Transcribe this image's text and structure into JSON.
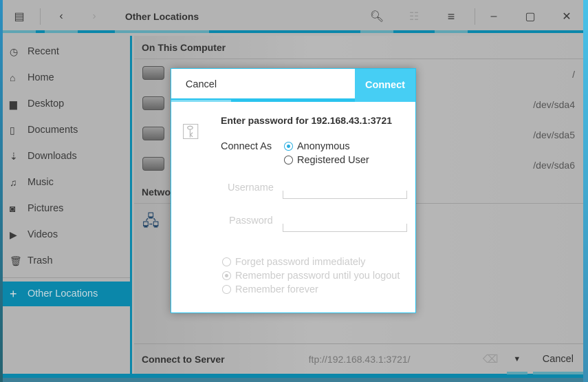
{
  "header": {
    "title": "Other Locations",
    "icons": [
      "files-app-icon",
      "back-icon",
      "forward-icon",
      "search-icon",
      "list-view-icon",
      "menu-icon",
      "minimize-icon",
      "maximize-icon",
      "close-icon"
    ]
  },
  "sidebar": {
    "items": [
      {
        "label": "Recent",
        "icon": "clock-icon"
      },
      {
        "label": "Home",
        "icon": "home-icon"
      },
      {
        "label": "Desktop",
        "icon": "folder-icon"
      },
      {
        "label": "Documents",
        "icon": "document-icon"
      },
      {
        "label": "Downloads",
        "icon": "download-icon"
      },
      {
        "label": "Music",
        "icon": "music-icon"
      },
      {
        "label": "Pictures",
        "icon": "camera-icon"
      },
      {
        "label": "Videos",
        "icon": "video-icon"
      },
      {
        "label": "Trash",
        "icon": "trash-icon"
      }
    ],
    "other": {
      "label": "Other Locations",
      "icon": "plus-icon"
    }
  },
  "main": {
    "on_this_computer": "On This Computer",
    "drives": [
      {
        "path": "/"
      },
      {
        "path": "/dev/sda4"
      },
      {
        "path": "/dev/sda5"
      },
      {
        "path": "/dev/sda6"
      }
    ],
    "network": "Networks"
  },
  "bottom": {
    "label": "Connect to Server",
    "placeholder": "ftp://192.168.43.1:3721/",
    "cancel": "Cancel"
  },
  "dialog": {
    "cancel": "Cancel",
    "connect": "Connect",
    "prompt": "Enter password for 192.168.43.1:3721",
    "connect_as": "Connect As",
    "options": [
      "Anonymous",
      "Registered User"
    ],
    "selected": "Anonymous",
    "username_label": "Username",
    "password_label": "Password",
    "remember": [
      "Forget password immediately",
      "Remember password until you logout",
      "Remember forever"
    ],
    "remember_selected": "Remember password until you logout"
  },
  "colors": {
    "accent": "#0b87aa",
    "dialog_accent": "#46cef4"
  }
}
